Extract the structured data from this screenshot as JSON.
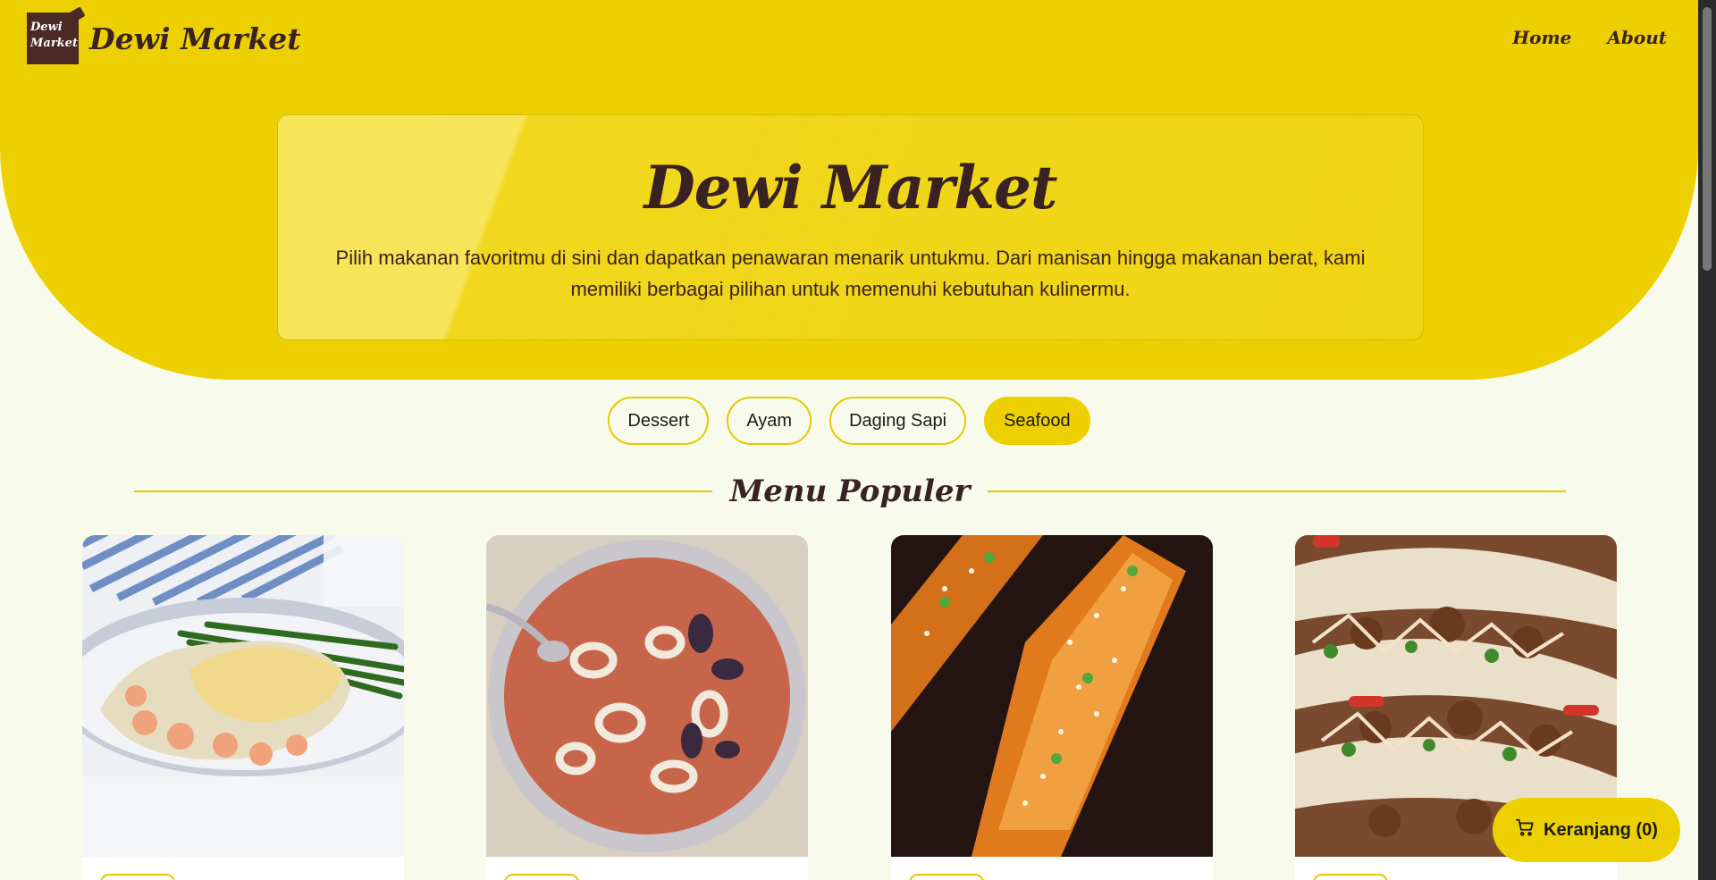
{
  "brand": {
    "logo_line1": "Dewi",
    "logo_line2": "Market",
    "name": "Dewi Market"
  },
  "nav": {
    "home": "Home",
    "about": "About"
  },
  "hero": {
    "title": "Dewi Market",
    "description": "Pilih makanan favoritmu di sini dan dapatkan penawaran menarik untukmu. Dari manisan hingga makanan berat, kami memiliki berbagai pilihan untuk memenuhi kebutuhan kulinermu."
  },
  "filters": [
    {
      "label": "Dessert",
      "active": false
    },
    {
      "label": "Ayam",
      "active": false
    },
    {
      "label": "Daging Sapi",
      "active": false
    },
    {
      "label": "Seafood",
      "active": true
    }
  ],
  "section": {
    "title": "Menu Populer"
  },
  "cards": [
    {
      "image": "seafood-pie-photo"
    },
    {
      "image": "seafood-soup-photo"
    },
    {
      "image": "glazed-salmon-photo"
    },
    {
      "image": "fish-tacos-photo"
    }
  ],
  "cart": {
    "label": "Keranjang (0)",
    "icon": "cart-icon"
  },
  "colors": {
    "accent": "#edd001",
    "background": "#f8fbec",
    "text": "#3a2222"
  }
}
